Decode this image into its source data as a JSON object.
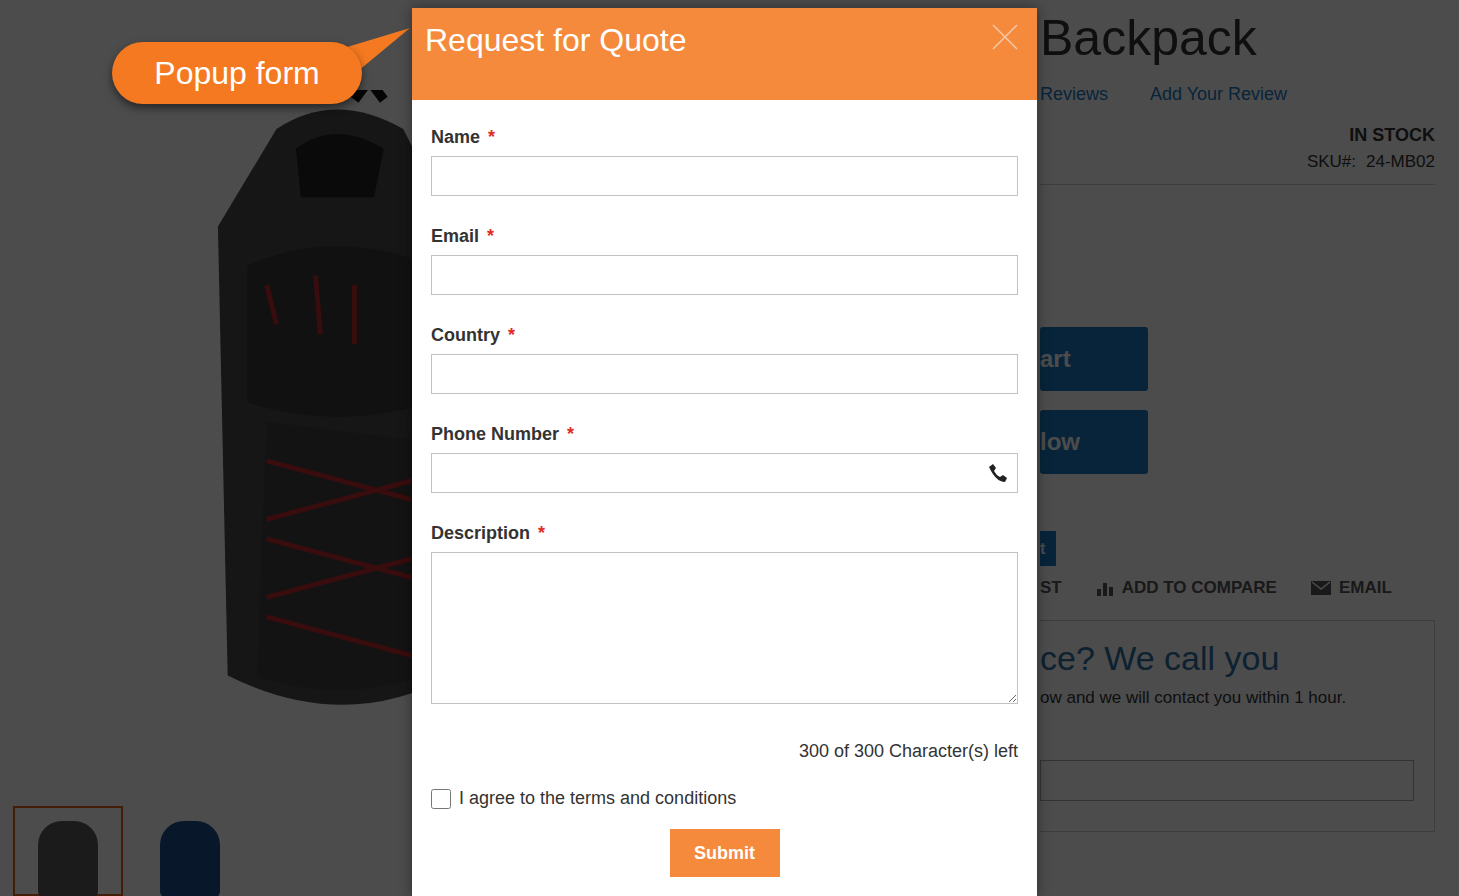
{
  "annotation": {
    "label": "Popup form"
  },
  "product": {
    "title": "Backpack",
    "links": [
      "Reviews",
      "Add Your Review"
    ],
    "stock": "IN STOCK",
    "sku_label": "SKU#:",
    "sku": "24-MB02",
    "buttons": [
      "art",
      "low"
    ],
    "small_button": "t",
    "actions": [
      {
        "label": "ST",
        "kind": "text"
      },
      {
        "label": "ADD TO COMPARE",
        "kind": "compare"
      },
      {
        "label": "EMAIL",
        "kind": "email"
      }
    ]
  },
  "callback": {
    "heading": "ce? We call you",
    "text": "ow and we will contact you within 1 hour."
  },
  "thumbnails": [
    {
      "selected": true,
      "color": "#5a5a5a"
    },
    {
      "selected": false,
      "color": "#1f4e8c"
    }
  ],
  "modal": {
    "title": "Request for Quote",
    "required_mark": "*",
    "fields": [
      {
        "label": "Name",
        "required": true,
        "kind": "text"
      },
      {
        "label": "Email",
        "required": true,
        "kind": "text"
      },
      {
        "label": "Country",
        "required": true,
        "kind": "text"
      },
      {
        "label": "Phone Number",
        "required": true,
        "kind": "phone"
      },
      {
        "label": "Description",
        "required": true,
        "kind": "textarea"
      }
    ],
    "counter": "300 of 300 Character(s) left",
    "terms": {
      "label": "I agree to the terms and conditions",
      "checked": false
    },
    "submit": "Submit"
  }
}
